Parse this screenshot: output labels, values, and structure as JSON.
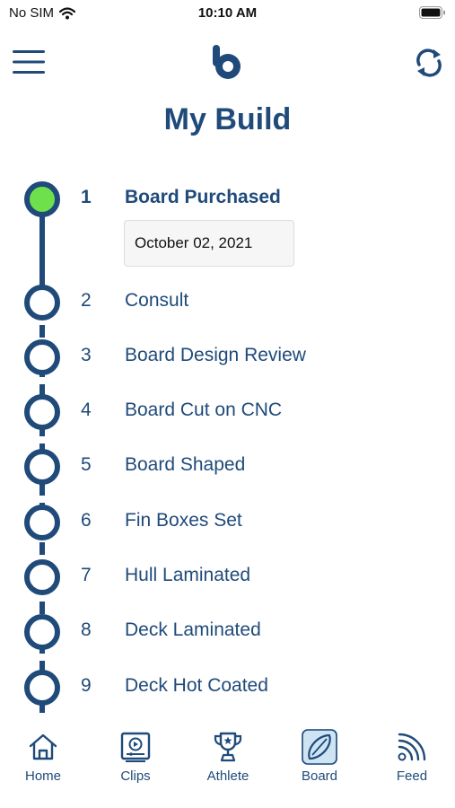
{
  "status_bar": {
    "carrier": "No SIM",
    "time": "10:10 AM"
  },
  "header": {
    "title": "My Build"
  },
  "steps": [
    {
      "num": "1",
      "label": "Board Purchased",
      "done": true,
      "date": "October 02, 2021"
    },
    {
      "num": "2",
      "label": "Consult",
      "done": false
    },
    {
      "num": "3",
      "label": "Board Design Review",
      "done": false
    },
    {
      "num": "4",
      "label": "Board Cut on CNC",
      "done": false
    },
    {
      "num": "5",
      "label": "Board Shaped",
      "done": false
    },
    {
      "num": "6",
      "label": "Fin Boxes Set",
      "done": false
    },
    {
      "num": "7",
      "label": "Hull Laminated",
      "done": false
    },
    {
      "num": "8",
      "label": "Deck Laminated",
      "done": false
    },
    {
      "num": "9",
      "label": "Deck Hot Coated",
      "done": false
    }
  ],
  "tabs": [
    {
      "label": "Home",
      "icon": "home-icon"
    },
    {
      "label": "Clips",
      "icon": "video-icon"
    },
    {
      "label": "Athlete",
      "icon": "trophy-icon"
    },
    {
      "label": "Board",
      "icon": "surfboard-icon",
      "active": true
    },
    {
      "label": "Feed",
      "icon": "rss-icon"
    }
  ],
  "colors": {
    "primary": "#1f4a7a",
    "done_node": "#6ee04c",
    "active_tab_bg": "#cfe4f3"
  }
}
